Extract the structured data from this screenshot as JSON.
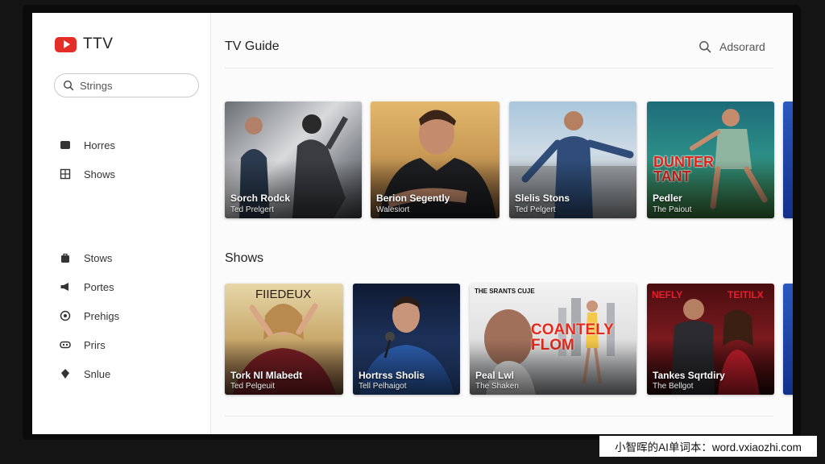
{
  "app": {
    "name": "TTV"
  },
  "sidebar": {
    "search_label": "Strings",
    "items_top": [
      {
        "label": "Horres",
        "icon": "home-icon"
      },
      {
        "label": "Shows",
        "icon": "grid-icon"
      }
    ],
    "items_bottom": [
      {
        "label": "Stows",
        "icon": "bag-icon"
      },
      {
        "label": "Portes",
        "icon": "megaphone-icon"
      },
      {
        "label": "Prehigs",
        "icon": "settings-icon"
      },
      {
        "label": "Prirs",
        "icon": "gamepad-icon"
      },
      {
        "label": "Snlue",
        "icon": "pin-icon"
      }
    ]
  },
  "header": {
    "title": "TV Guide",
    "search_label": "Adsorard"
  },
  "rows": [
    {
      "title": "",
      "cards": [
        {
          "title": "Sorch Rodck",
          "subtitle": "Ted Prelgert",
          "overlay": ""
        },
        {
          "title": "Berion Segently",
          "subtitle": "Walesiort",
          "overlay": ""
        },
        {
          "title": "Slelis Stons",
          "subtitle": "Ted Pelgert",
          "overlay": ""
        },
        {
          "title": "Pedler",
          "subtitle": "The Paiout",
          "overlay": "DUNTER\nTANT"
        }
      ]
    },
    {
      "title": "Shows",
      "cards": [
        {
          "title": "Tork Nl Mlabedt",
          "subtitle": "Ted Pelgeuit",
          "overlay": "FIIEDEUX"
        },
        {
          "title": "Hortrss Sholis",
          "subtitle": "Tell Pelhaigot",
          "overlay": ""
        },
        {
          "title": "Peal Lwl",
          "subtitle": "The Shaken",
          "overlay": "COANTELY\nFLOM",
          "tag": "THE SRANTS CUJE"
        },
        {
          "title": "Tankes Sqrtdiry",
          "subtitle": "The Bellgot",
          "overlay": "NEFLY",
          "overlay2": "TEITILX"
        }
      ]
    }
  ],
  "watermark": "小智晖的AI单词本：word.vxiaozhi.com",
  "colors": {
    "brand": "#e52d27",
    "background": "#fbfbfb",
    "frame": "#0b0b0b"
  }
}
